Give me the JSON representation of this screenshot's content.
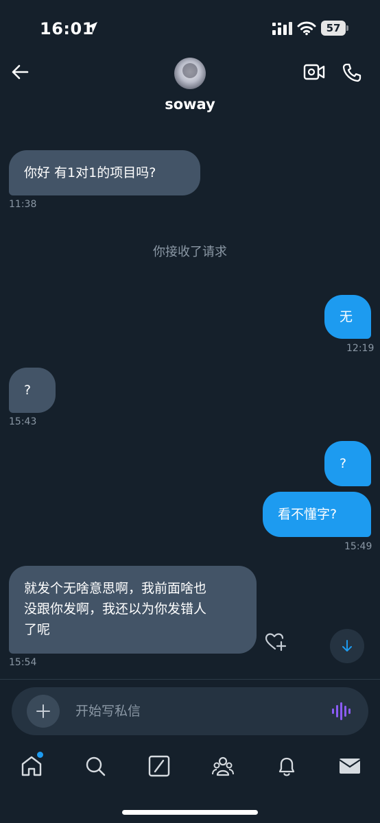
{
  "status_bar": {
    "time": "16:01",
    "battery": "57"
  },
  "header": {
    "contact_name": "soway"
  },
  "messages": [
    {
      "text": "你好  有1对1的项目吗?",
      "time": "11:38"
    },
    {
      "text": "无",
      "time": "12:19"
    },
    {
      "text": "?",
      "time": "15:43"
    },
    {
      "text": "?",
      "time": ""
    },
    {
      "text": "看不懂字?",
      "time": "15:49"
    },
    {
      "text_lines": [
        "就发个无啥意思啊，我前面啥也",
        "没跟你发啊，我还以为你发错人",
        "了呢"
      ],
      "time": "15:54"
    }
  ],
  "system_note": "你接收了请求",
  "composer": {
    "placeholder": "开始写私信"
  },
  "colors": {
    "background": "#15202b",
    "incoming_bubble": "#435467",
    "outgoing_bubble": "#1d9bf0",
    "muted_text": "#8b98a5",
    "accent": "#1d9bf0",
    "voice_accent": "#8b5cf6"
  },
  "icons": {
    "status": [
      "location-arrow-icon",
      "signal-icon",
      "wifi-icon",
      "battery-icon"
    ],
    "header": [
      "back-arrow-icon",
      "video-call-icon",
      "phone-icon"
    ],
    "composer": [
      "plus-icon",
      "voice-waveform-icon"
    ],
    "message": [
      "heart-plus-icon",
      "arrow-down-icon"
    ],
    "tabs": [
      "home-icon",
      "search-icon",
      "grok-icon",
      "communities-icon",
      "notifications-icon",
      "messages-icon"
    ]
  }
}
